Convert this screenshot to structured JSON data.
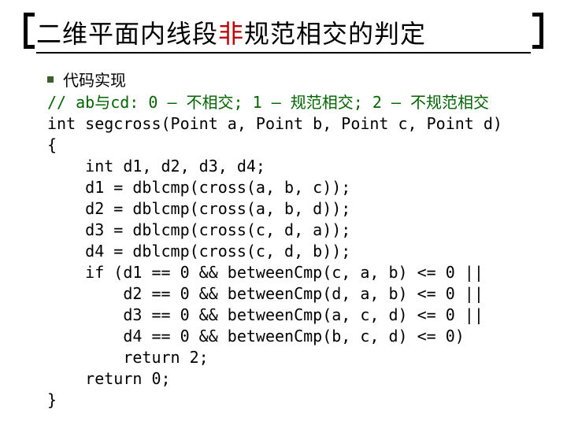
{
  "title": {
    "part1": "二维平面内线段",
    "highlight": "非",
    "part2": "规范相交的判定"
  },
  "bullet": "代码实现",
  "code": {
    "c1": "// ab与cd: 0 – 不相交; 1 – 规范相交; 2 – 不规范相交",
    "l2": "int segcross(Point a, Point b, Point c, Point d)",
    "l3": "{",
    "l4": "    int d1, d2, d3, d4;",
    "l5": "    d1 = dblcmp(cross(a, b, c));",
    "l6": "    d2 = dblcmp(cross(a, b, d));",
    "l7": "    d3 = dblcmp(cross(c, d, a));",
    "l8": "    d4 = dblcmp(cross(c, d, b));",
    "l9": "    if (d1 == 0 && betweenCmp(c, a, b) <= 0 ||",
    "l10": "        d2 == 0 && betweenCmp(d, a, b) <= 0 ||",
    "l11": "        d3 == 0 && betweenCmp(a, c, d) <= 0 ||",
    "l12": "        d4 == 0 && betweenCmp(b, c, d) <= 0)",
    "l13": "        return 2;",
    "l14": "    return 0;",
    "l15": "}"
  }
}
